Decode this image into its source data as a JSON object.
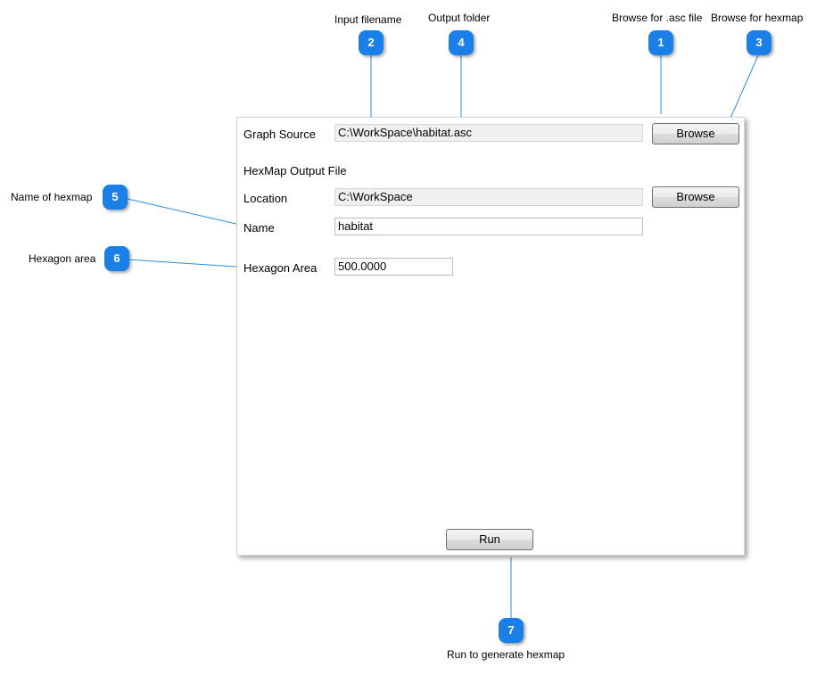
{
  "form": {
    "graph_source_label": "Graph Source",
    "graph_source_value": "C:\\WorkSpace\\habitat.asc",
    "browse_source_label": "Browse",
    "section_title": "HexMap Output File",
    "location_label": "Location",
    "location_value": "C:\\WorkSpace",
    "browse_location_label": "Browse",
    "name_label": "Name",
    "name_value": "habitat",
    "hex_area_label": "Hexagon Area",
    "hex_area_value": "500.0000",
    "run_label": "Run"
  },
  "callouts": {
    "c1": {
      "number": "1",
      "text": "Browse for .asc file"
    },
    "c2": {
      "number": "2",
      "text": "Input filename"
    },
    "c3": {
      "number": "3",
      "text": "Browse for hexmap"
    },
    "c4": {
      "number": "4",
      "text": "Output folder"
    },
    "c5": {
      "number": "5",
      "text": "Name of hexmap"
    },
    "c6": {
      "number": "6",
      "text": "Hexagon area"
    },
    "c7": {
      "number": "7",
      "text": "Run to generate hexmap"
    }
  },
  "colors": {
    "callout_fill": "#1a7fe6",
    "leader_line": "#2a8fd8"
  }
}
